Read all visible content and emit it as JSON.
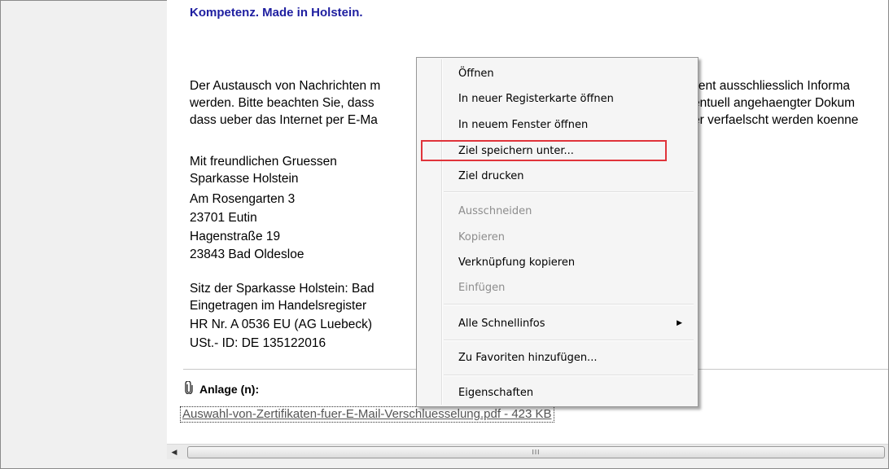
{
  "email": {
    "brand_title": "Kompetenz. Made in Holstein.",
    "disclaimer_lines": [
      "Der Austausch von Nachrichten m",
      "werden. Bitte beachten Sie, dass",
      "dass ueber das Internet per E-Ma"
    ],
    "disclaimer_right_lines": [
      "lient ausschliesslich Informa",
      "entuell angehaengter Dokum",
      "er verfaelscht werden koenne"
    ],
    "signature_lines": [
      "Mit freundlichen Gruessen",
      "Sparkasse Holstein",
      "Am Rosengarten 3",
      "23701 Eutin",
      "Hagenstraße 19",
      "23843 Bad Oldesloe"
    ],
    "legal_lines": [
      "Sitz der Sparkasse Holstein: Bad",
      "Eingetragen im Handelsregister",
      "HR Nr. A 0536 EU (AG Luebeck)",
      "USt.- ID: DE 135122016"
    ],
    "attachment_heading": "Anlage (n):",
    "attachment_link": "Auswahl-von-Zertifikaten-fuer-E-Mail-Verschluesselung.pdf - 423 KB"
  },
  "context_menu": {
    "items": [
      {
        "label": "Öffnen",
        "enabled": true
      },
      {
        "label": "In neuer Registerkarte öffnen",
        "enabled": true
      },
      {
        "label": "In neuem Fenster öffnen",
        "enabled": true
      },
      {
        "label": "Ziel speichern unter...",
        "enabled": true,
        "highlighted": true
      },
      {
        "label": "Ziel drucken",
        "enabled": true
      },
      {
        "label": "Ausschneiden",
        "enabled": false
      },
      {
        "label": "Kopieren",
        "enabled": false
      },
      {
        "label": "Verknüpfung kopieren",
        "enabled": true
      },
      {
        "label": "Einfügen",
        "enabled": false
      },
      {
        "label": "Alle Schnellinfos",
        "enabled": true,
        "submenu": true
      },
      {
        "label": "Zu Favoriten hinzufügen...",
        "enabled": true
      },
      {
        "label": "Eigenschaften",
        "enabled": true
      }
    ],
    "highlight_color": "#e0343b"
  },
  "scrollbar": {
    "grip": "III",
    "left_arrow": "◀"
  },
  "icons": {
    "attachment": "paperclip-icon",
    "submenu": "chevron-right-icon"
  }
}
